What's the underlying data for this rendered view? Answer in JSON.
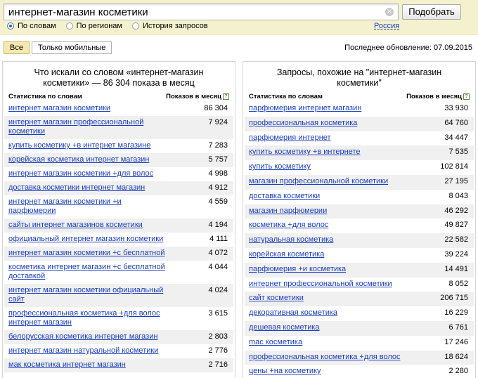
{
  "search": {
    "value": "интернет-магазин косметики",
    "clear_symbol": "×",
    "submit_label": "Подобрать"
  },
  "modes": [
    {
      "label": "По словам",
      "selected": true
    },
    {
      "label": "По регионам",
      "selected": false
    },
    {
      "label": "История запросов",
      "selected": false
    }
  ],
  "region": "Россия",
  "filters": [
    {
      "label": "Все",
      "active": true
    },
    {
      "label": "Только мобильные",
      "active": false
    }
  ],
  "updated": "Последнее обновление: 07.09.2015",
  "left": {
    "title": "Что искали со словом «интернет-магазин косметики» — 86 304 показа в месяц",
    "col_keyword": "Статистика по словам",
    "col_count": "Показов в месяц",
    "rows": [
      {
        "kw": "интернет магазин косметики",
        "n": "86 304"
      },
      {
        "kw": "интернет магазин профессиональной косметики",
        "n": "7 924"
      },
      {
        "kw": "купить косметику +в интернет магазине",
        "n": "7 283"
      },
      {
        "kw": "корейская косметика интернет магазин",
        "n": "5 757"
      },
      {
        "kw": "интернет магазин косметики +для волос",
        "n": "4 998"
      },
      {
        "kw": "доставка косметики интернет магазин",
        "n": "4 912"
      },
      {
        "kw": "интернет магазин косметики +и парфюмерии",
        "n": "4 559"
      },
      {
        "kw": "сайты интернет магазинов косметики",
        "n": "4 194"
      },
      {
        "kw": "официальный интернет магазин косметики",
        "n": "4 111"
      },
      {
        "kw": "интернет магазин косметики +с бесплатной",
        "n": "4 072"
      },
      {
        "kw": "косметика интернет магазин +с бесплатной доставкой",
        "n": "4 044"
      },
      {
        "kw": "интернет магазин косметики официальный сайт",
        "n": "4 024"
      },
      {
        "kw": "профессиональная косметика +для волос интернет магазин",
        "n": "3 615"
      },
      {
        "kw": "белорусская косметика интернет магазин",
        "n": "2 803"
      },
      {
        "kw": "интернет магазин натуральной косметики",
        "n": "2 776"
      },
      {
        "kw": "мак косметика интернет магазин",
        "n": "2 716"
      }
    ]
  },
  "right": {
    "title": "Запросы, похожие на \"интернет-магазин косметики\"",
    "col_keyword": "Статистика по словам",
    "col_count": "Показов в месяц",
    "rows": [
      {
        "kw": "парфюмерия интернет магазин",
        "n": "33 930"
      },
      {
        "kw": "профессиональная косметика",
        "n": "64 760"
      },
      {
        "kw": "парфюмерия интернет",
        "n": "34 447"
      },
      {
        "kw": "купить косметику +в интернете",
        "n": "7 535"
      },
      {
        "kw": "купить косметику",
        "n": "102 814"
      },
      {
        "kw": "магазин профессиональной косметики",
        "n": "27 195"
      },
      {
        "kw": "доставка косметики",
        "n": "8 043"
      },
      {
        "kw": "магазин парфюмерии",
        "n": "46 292"
      },
      {
        "kw": "косметика +для волос",
        "n": "49 827"
      },
      {
        "kw": "натуральная косметика",
        "n": "22 582"
      },
      {
        "kw": "корейская косметика",
        "n": "39 224"
      },
      {
        "kw": "парфюмерия +и косметика",
        "n": "14 491"
      },
      {
        "kw": "интернет профессиональной косметики",
        "n": "8 052"
      },
      {
        "kw": "сайт косметики",
        "n": "206 715"
      },
      {
        "kw": "декоративная косметика",
        "n": "16 229"
      },
      {
        "kw": "дешевая косметика",
        "n": "6 761"
      },
      {
        "kw": "mac косметика",
        "n": "17 246"
      },
      {
        "kw": "профессиональная косметика +для волос",
        "n": "18 624"
      },
      {
        "kw": "цены +на косметику",
        "n": "2 280"
      }
    ]
  }
}
